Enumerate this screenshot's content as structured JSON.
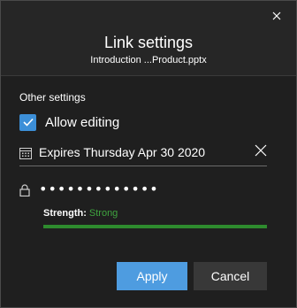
{
  "dialog": {
    "title": "Link settings",
    "subtitle": "Introduction ...Product.pptx"
  },
  "other_settings": {
    "section_label": "Other settings",
    "allow_editing": {
      "label": "Allow editing",
      "checked": true
    },
    "expiry": {
      "prefix": "Expires",
      "date": "Thursday Apr 30 2020",
      "icon": "calendar-icon"
    },
    "password": {
      "value": "•••••••••••••",
      "icon": "lock-icon"
    },
    "strength": {
      "label": "Strength:",
      "value": "Strong",
      "level": 1.0
    }
  },
  "buttons": {
    "apply": "Apply",
    "cancel": "Cancel"
  },
  "colors": {
    "accent": "#4e9ce0",
    "checkbox": "#3c8fd8",
    "strength_text": "#3fa43f",
    "strength_bar": "#2e8b2e",
    "background": "#1f1f1f"
  }
}
